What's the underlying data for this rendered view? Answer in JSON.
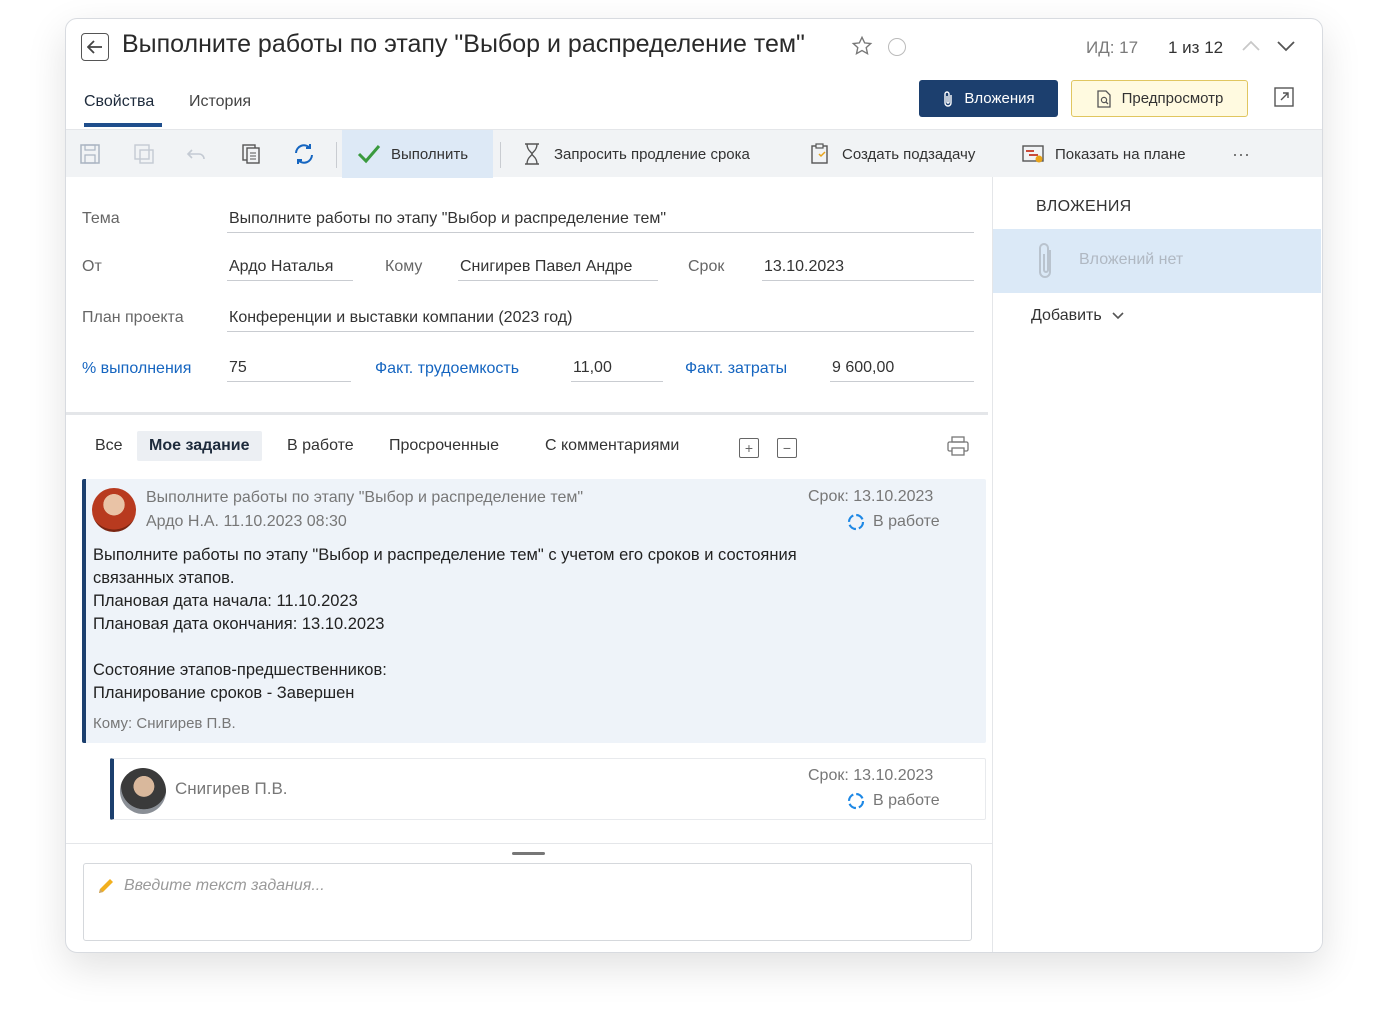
{
  "header": {
    "title": "Выполните работы по этапу \"Выбор и распределение тем\"",
    "id_label": "ИД: 17",
    "pager": "1 из 12"
  },
  "tabs": [
    {
      "label": "Свойства",
      "active": true
    },
    {
      "label": "История",
      "active": false
    }
  ],
  "actions": {
    "attachments_label": "Вложения",
    "preview_label": "Предпросмотр"
  },
  "toolbar": {
    "complete_label": "Выполнить",
    "extend_label": "Запросить продление срока",
    "subtask_label": "Создать подзадачу",
    "show_plan_label": "Показать на плане",
    "more_label": "···"
  },
  "form": {
    "subject_label": "Тема",
    "subject_value": "Выполните работы по этапу \"Выбор и распределение тем\"",
    "from_label": "От",
    "from_value": "Ардо Наталья",
    "to_label": "Кому",
    "to_value": "Снигирев Павел Андре",
    "deadline_label": "Срок",
    "deadline_value": "13.10.2023",
    "plan_label": "План проекта",
    "plan_value": "Конференции и выставки компании (2023 год)",
    "percent_label": "% выполнения",
    "percent_value": "75",
    "labor_label": "Факт. трудоемкость",
    "labor_value": "11,00",
    "cost_label": "Факт. затраты",
    "cost_value": "9 600,00"
  },
  "filters": {
    "all": "Все",
    "mine": "Мое задание",
    "in_progress": "В работе",
    "overdue": "Просроченные",
    "with_comments": "С комментариями"
  },
  "task_card": {
    "title": "Выполните работы по этапу \"Выбор и распределение тем\"",
    "author_time": "Ардо Н.А.  11.10.2023 08:30",
    "deadline": "Срок: 13.10.2023",
    "status": "В работе",
    "body_line1": "Выполните работы по этапу \"Выбор и распределение тем\" с учетом его сроков и состояния",
    "body_line2": "связанных этапов.",
    "body_line3": "Плановая дата начала: 11.10.2023",
    "body_line4": "Плановая дата окончания: 13.10.2023",
    "body_line5": "Состояние этапов-предшественников:",
    "body_line6": "Планирование сроков - Завершен",
    "to": "Кому: Снигирев П.В."
  },
  "sub_card": {
    "name": "Снигирев П.В.",
    "deadline": "Срок: 13.10.2023",
    "status": "В работе"
  },
  "comment": {
    "placeholder": "Введите текст задания..."
  },
  "attachments_pane": {
    "title": "ВЛОЖЕНИЯ",
    "empty": "Вложений нет",
    "add_label": "Добавить"
  },
  "colors": {
    "primary": "#1c3f6e",
    "link": "#1565c0",
    "status": "#1e88e5",
    "card_bg": "#eef3f9"
  }
}
